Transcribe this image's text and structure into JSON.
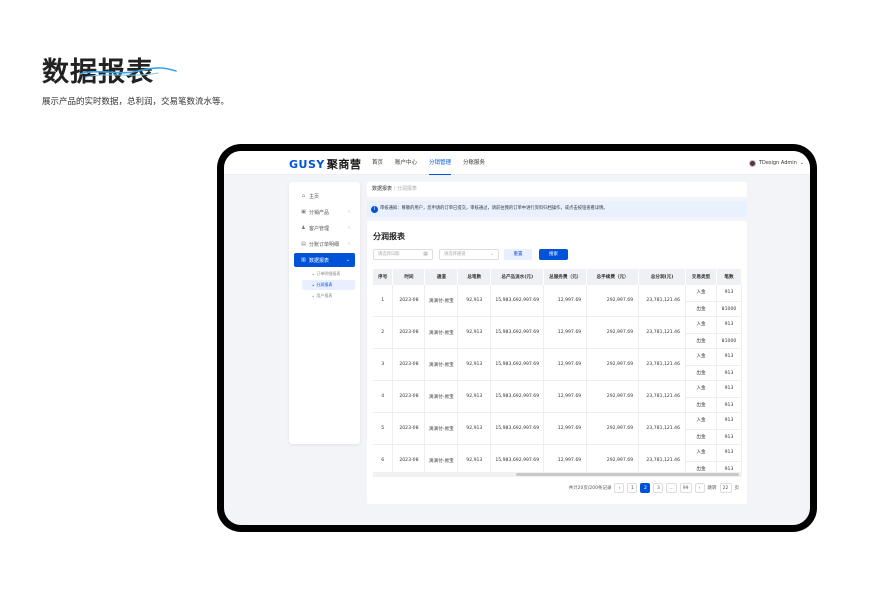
{
  "hero": {
    "title": "数据报表",
    "desc": "展示产品的实时数据，总利润，交易笔数流水等。"
  },
  "app": {
    "logo_en": "GUSY",
    "logo_cn": "聚商营",
    "nav": [
      "首页",
      "账户中心",
      "分销管理",
      "分账服务"
    ],
    "nav_active": 2,
    "user": "TDesign Admin",
    "user_chevron": "⌄"
  },
  "sidebar": {
    "items": [
      {
        "label": "主页",
        "icon": "home-icon",
        "glyph": "⌂",
        "chev": ""
      },
      {
        "label": "分销产品",
        "icon": "box-icon",
        "glyph": "▣",
        "chev": "›"
      },
      {
        "label": "客户管理",
        "icon": "user-icon",
        "glyph": "♟",
        "chev": "›"
      },
      {
        "label": "分账订单明细",
        "icon": "order-icon",
        "glyph": "▤",
        "chev": "›"
      },
      {
        "label": "数据报表",
        "icon": "report-icon",
        "glyph": "▥",
        "chev": "⌄"
      }
    ],
    "subitems": [
      {
        "label": "订单明细报表"
      },
      {
        "label": "分润报表"
      },
      {
        "label": "用户报表"
      }
    ]
  },
  "breadcrumb": {
    "root": "数据报表",
    "sep": " / ",
    "current": "分润报表"
  },
  "notice": {
    "icon": "i",
    "text": "审核通知：尊敬的用户，您申请的订单已提交，审核通过，请前往我的订单中进行资料归档操作，或点击按钮查看详情。"
  },
  "report": {
    "title": "分润报表",
    "filters": [
      {
        "placeholder": "请选择日期",
        "icon": "calendar-icon",
        "glyph": "▦"
      },
      {
        "placeholder": "请选择通道",
        "icon": "chevron-down-icon",
        "glyph": "⌄"
      }
    ],
    "reset_label": "重置",
    "query_label": "搜索",
    "columns": [
      "序号",
      "时间",
      "通道",
      "总笔数",
      "总产品流水(元)",
      "总服务费（元）",
      "总手续费（元）",
      "总分润(元)",
      "交易类型",
      "笔数"
    ],
    "rows": [
      {
        "no": "1",
        "time": "2023-08",
        "channel": "滴滴付-易宝",
        "count": "92,913",
        "flow": "15,983,692,997.69",
        "service": "12,997.69",
        "fee": "292,997.69",
        "profit": "23,781,121.46",
        "types": [
          "入金",
          "出金"
        ],
        "counts": [
          "913",
          "81000"
        ]
      },
      {
        "no": "2",
        "time": "2023-08",
        "channel": "滴滴付-易宝",
        "count": "92,913",
        "flow": "15,983,692,997.69",
        "service": "12,997.69",
        "fee": "292,997.69",
        "profit": "23,781,121.46",
        "types": [
          "入金",
          "出金"
        ],
        "counts": [
          "913",
          "81000"
        ]
      },
      {
        "no": "3",
        "time": "2023-08",
        "channel": "滴滴付-易宝",
        "count": "92,913",
        "flow": "15,983,692,997.69",
        "service": "12,997.69",
        "fee": "292,997.69",
        "profit": "23,781,121.46",
        "types": [
          "入金",
          "出金"
        ],
        "counts": [
          "913",
          "913"
        ]
      },
      {
        "no": "4",
        "time": "2023-08",
        "channel": "滴滴付-易宝",
        "count": "92,913",
        "flow": "15,983,692,997.69",
        "service": "12,997.69",
        "fee": "292,997.69",
        "profit": "23,781,121.46",
        "types": [
          "入金",
          "出金"
        ],
        "counts": [
          "913",
          "913"
        ]
      },
      {
        "no": "5",
        "time": "2023-08",
        "channel": "滴滴付-易宝",
        "count": "92,913",
        "flow": "15,983,692,997.69",
        "service": "12,997.69",
        "fee": "292,997.69",
        "profit": "23,781,121.46",
        "types": [
          "入金",
          "出金"
        ],
        "counts": [
          "913",
          "913"
        ]
      },
      {
        "no": "6",
        "time": "2023-08",
        "channel": "滴滴付-易宝",
        "count": "92,913",
        "flow": "15,983,692,997.69",
        "service": "12,997.69",
        "fee": "292,997.69",
        "profit": "23,781,121.46",
        "types": [
          "入金",
          "出金"
        ],
        "counts": [
          "913",
          "913"
        ]
      }
    ],
    "pagination": {
      "summary": "共计20页/200条记录",
      "prev": "‹",
      "pages": [
        "1",
        "2",
        "3",
        "...",
        "99"
      ],
      "active_page": "2",
      "next": "›",
      "jump_label": "跳转",
      "jump_value": "22",
      "page_unit": "页"
    }
  },
  "colors": {
    "accent": "#0052d9",
    "frame": "#000000",
    "background": "#f3f4f8"
  }
}
